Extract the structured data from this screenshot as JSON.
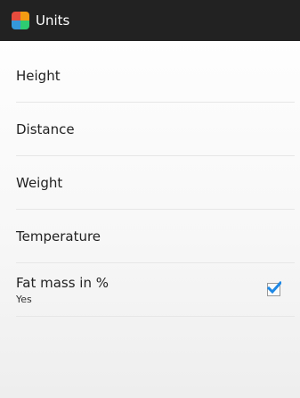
{
  "header": {
    "title": "Units",
    "icon": "app-icon",
    "icon_colors": [
      "#e84c3d",
      "#f39c12",
      "#3498db",
      "#2ecc71"
    ]
  },
  "settings": [
    {
      "label": "Height"
    },
    {
      "label": "Distance"
    },
    {
      "label": "Weight"
    },
    {
      "label": "Temperature"
    },
    {
      "label": "Fat mass in %",
      "summary": "Yes",
      "checked": true
    }
  ],
  "colors": {
    "action_bar": "#222222",
    "check_accent": "#1e88e5"
  }
}
